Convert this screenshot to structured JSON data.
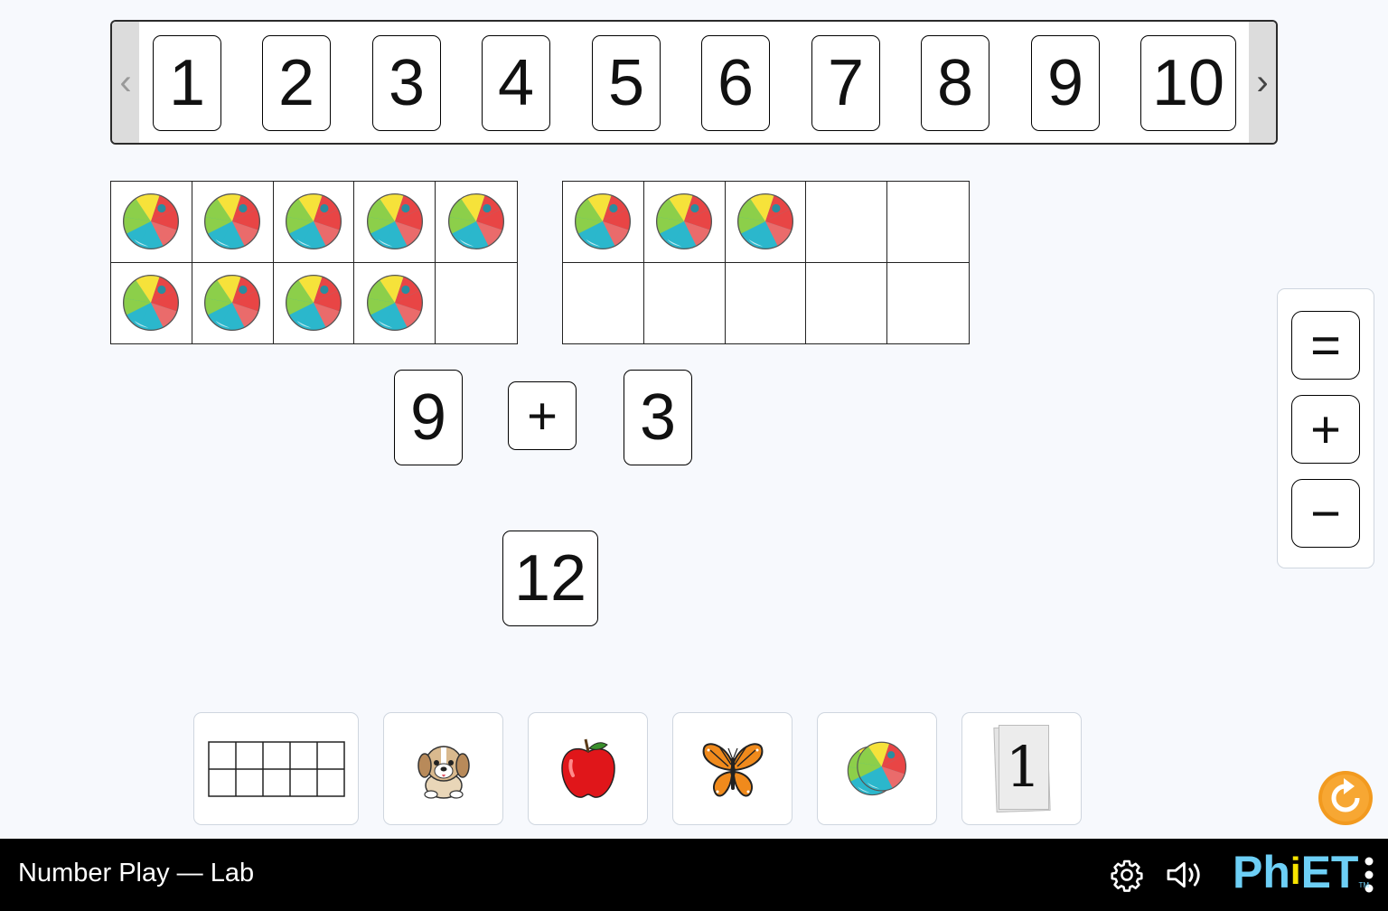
{
  "app": {
    "title": "Number Play — Lab"
  },
  "carousel": {
    "prev_label": "‹",
    "next_label": "›",
    "cards": [
      "1",
      "2",
      "3",
      "4",
      "5",
      "6",
      "7",
      "8",
      "9",
      "10"
    ]
  },
  "ten_frames": [
    {
      "filled": 9,
      "capacity": 10,
      "object": "beach-ball"
    },
    {
      "filled": 3,
      "capacity": 10,
      "object": "beach-ball"
    }
  ],
  "equation": {
    "left_operand": "9",
    "operator": "+",
    "right_operand": "3",
    "result": "12"
  },
  "operators": {
    "equals": "=",
    "plus": "+",
    "minus": "−"
  },
  "toolbox": {
    "items": [
      "ten-frame",
      "puppy",
      "apple",
      "butterfly",
      "beach-ball",
      "paper-number"
    ],
    "paper_number_label": "1"
  },
  "colors": {
    "background": "#f7f9fd",
    "nav_bar": "#000000",
    "reset_orange": "#f29a1f",
    "phet_blue": "#6dcff6",
    "phet_yellow": "#f7e400"
  },
  "brand": {
    "ph": "Ph",
    "i": "i",
    "et": "ET",
    "tm": "TM"
  }
}
